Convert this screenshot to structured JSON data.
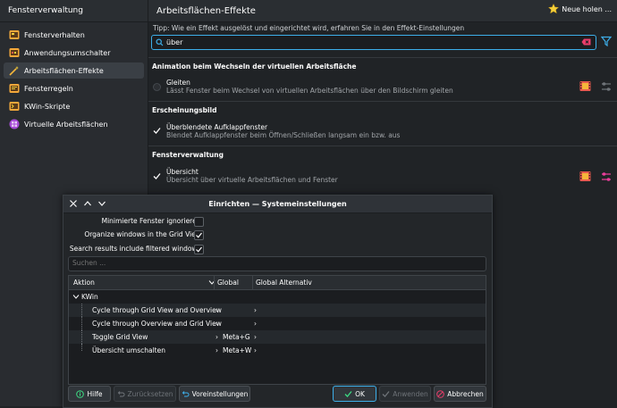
{
  "colors": {
    "accent": "#3daee9",
    "bg": "#202326",
    "sidebar": "#292c30",
    "film_red": "#e85a4f",
    "film_yellow": "#f4b63a",
    "config_active": "#e93d9a"
  },
  "sidebar": {
    "title": "Fensterverwaltung",
    "items": [
      {
        "label": "Fensterverhalten",
        "icon": "window-behavior-icon"
      },
      {
        "label": "Anwendungsumschalter",
        "icon": "task-switcher-icon"
      },
      {
        "label": "Arbeitsflächen-Effekte",
        "icon": "desktop-effects-icon"
      },
      {
        "label": "Fensterregeln",
        "icon": "window-rules-icon"
      },
      {
        "label": "KWin-Skripte",
        "icon": "kwin-scripts-icon"
      },
      {
        "label": "Virtuelle Arbeitsflächen",
        "icon": "virtual-desktops-icon"
      }
    ]
  },
  "main": {
    "title": "Arbeitsflächen-Effekte",
    "get_new": "Neue holen ...",
    "tip": "Tipp: Wie ein Effekt ausgelöst und eingerichtet wird, erfahren Sie in den Effekt-Einstellungen",
    "search_value": "über",
    "sections": [
      {
        "title": "Animation beim Wechseln der virtuellen Arbeitsfläche",
        "effect": {
          "name": "Gleiten",
          "desc": "Lässt Fenster beim Wechsel von virtuellen Arbeitsflächen über den Bildschirm gleiten"
        }
      },
      {
        "title": "Erscheinungsbild",
        "effect": {
          "name": "Überblendete Aufklappfenster",
          "desc": "Blendet Aufklappfenster beim Öffnen/Schließen langsam ein bzw. aus"
        }
      },
      {
        "title": "Fensterverwaltung",
        "effect": {
          "name": "Übersicht",
          "desc": "Übersicht über virtuelle Arbeitsflächen und Fenster"
        }
      }
    ]
  },
  "dialog": {
    "title": "Einrichten — Systemeinstellungen",
    "options": [
      {
        "label": "Minimierte Fenster ignorieren:",
        "checked": false
      },
      {
        "label": "Organize windows in the Grid View:",
        "checked": true
      },
      {
        "label": "Search results include filtered windows:",
        "checked": true
      }
    ],
    "search_placeholder": "Suchen ...",
    "columns": [
      "Aktion",
      "Global",
      "Global Alternativ"
    ],
    "group": "KWin",
    "rows": [
      {
        "action": "Cycle through Grid View and Overview",
        "global": "",
        "alt": ""
      },
      {
        "action": "Cycle through Overview and Grid View",
        "global": "",
        "alt": ""
      },
      {
        "action": "Toggle Grid View",
        "global": "Meta+G",
        "alt": ""
      },
      {
        "action": "Übersicht umschalten",
        "global": "Meta+W",
        "alt": ""
      }
    ],
    "buttons": {
      "help": "Hilfe",
      "reset": "Zurücksetzen",
      "defaults": "Voreinstellungen",
      "ok": "OK",
      "apply": "Anwenden",
      "cancel": "Abbrechen"
    }
  }
}
